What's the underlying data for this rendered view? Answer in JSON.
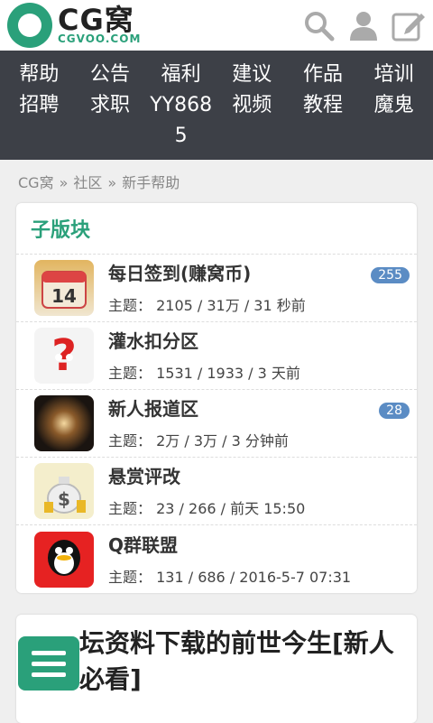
{
  "header": {
    "logo_main": "CG窝",
    "logo_sub": "CGVOO.COM",
    "icons": [
      "search-icon",
      "user-icon",
      "edit-icon"
    ]
  },
  "nav": {
    "columns": [
      [
        "帮助",
        "招聘"
      ],
      [
        "公告",
        "求职"
      ],
      [
        "福利",
        "YY8685"
      ],
      [
        "建议",
        "视频"
      ],
      [
        "作品",
        "教程"
      ],
      [
        "培训",
        "魔鬼"
      ]
    ]
  },
  "breadcrumb": [
    "CG窝",
    "社区",
    "新手帮助"
  ],
  "subforums": {
    "title": "子版块",
    "items": [
      {
        "name": "每日签到(赚窝币)",
        "meta": "主题： 2105 / 31万 / 31 秒前",
        "badge": "255",
        "icon": "calendar-14-icon"
      },
      {
        "name": "灌水扣分区",
        "meta": "主题： 1531 / 1933 / 3 天前",
        "badge": "",
        "icon": "question-mascot-icon"
      },
      {
        "name": "新人报道区",
        "meta": "主题： 2万 / 3万 / 3 分钟前",
        "badge": "28",
        "icon": "galaxy-icon"
      },
      {
        "name": "悬赏评改",
        "meta": "主题： 23 / 266 / 前天 15:50",
        "badge": "",
        "icon": "money-bag-icon"
      },
      {
        "name": "Q群联盟",
        "meta": "主题： 131 / 686 / 2016-5-7 07:31",
        "badge": "",
        "icon": "qq-penguin-icon"
      }
    ]
  },
  "post": {
    "title": "坛资料下载的前世今生[新人必看]"
  },
  "colors": {
    "accent": "#2aa07a",
    "nav_bg": "#3d4047",
    "badge": "#5b8cc4"
  }
}
